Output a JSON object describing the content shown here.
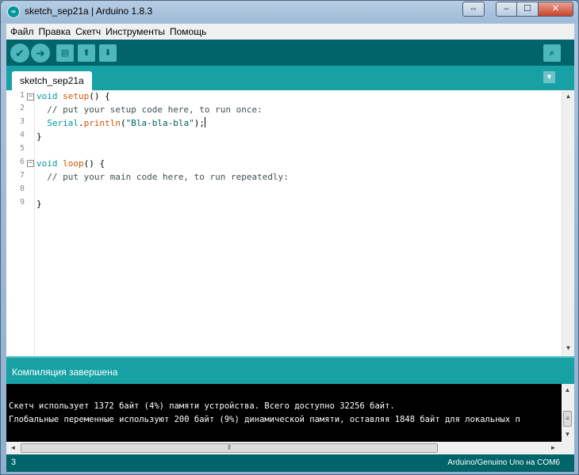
{
  "window": {
    "title": "sketch_sep21a | Arduino 1.8.3",
    "app_icon_glyph": "∞",
    "resize_glyph": "⇔",
    "minimize_glyph": "‒",
    "maximize_glyph": "☐",
    "close_glyph": "✕"
  },
  "menu": [
    "Файл",
    "Правка",
    "Скетч",
    "Инструменты",
    "Помощь"
  ],
  "toolbar": {
    "verify_glyph": "✔",
    "upload_glyph": "➜",
    "new_glyph": "▤",
    "open_glyph": "⬆",
    "save_glyph": "⬇",
    "serial_monitor_glyph": "⌕"
  },
  "tabs": {
    "active": "sketch_sep21a",
    "menu_glyph": "▼"
  },
  "editor": {
    "line_numbers": [
      "1",
      "2",
      "3",
      "4",
      "5",
      "6",
      "7",
      "8",
      "9"
    ],
    "fold_glyph": "−",
    "lines": [
      {
        "kw": "void",
        "fn": "setup",
        "rest": "() {"
      },
      {
        "indent": "  ",
        "comment": "// put your setup code here, to run once:"
      },
      {
        "indent": "  ",
        "kw": "Serial",
        "dot": ".",
        "fn": "println",
        "open": "(",
        "str": "\"Bla-bla-bla\"",
        "close": ");"
      },
      {
        "plain": "}"
      },
      {
        "plain": ""
      },
      {
        "kw": "void",
        "fn": "loop",
        "rest": "() {"
      },
      {
        "indent": "  ",
        "comment": "// put your main code here, to run repeatedly:"
      },
      {
        "plain": ""
      },
      {
        "plain": "}"
      }
    ],
    "scroll_up_glyph": "▲",
    "scroll_down_glyph": "▼"
  },
  "status": {
    "message": "Компиляция завершена"
  },
  "console": {
    "lines": [
      "",
      "Скетч использует 1372 байт (4%) памяти устройства. Всего доступно 32256 байт.",
      "Глобальные переменные используют 200 байт (9%) динамической памяти, оставляя 1848 байт для локальных п"
    ],
    "scroll_up_glyph": "▲",
    "scroll_down_glyph": "▼",
    "thumb_glyph": "≡",
    "hscroll_left_glyph": "◄",
    "hscroll_right_glyph": "►",
    "hthumb_glyph": "⦀"
  },
  "bottom": {
    "line_number": "3",
    "board": "Arduino/Genuino Uno на COM6"
  }
}
